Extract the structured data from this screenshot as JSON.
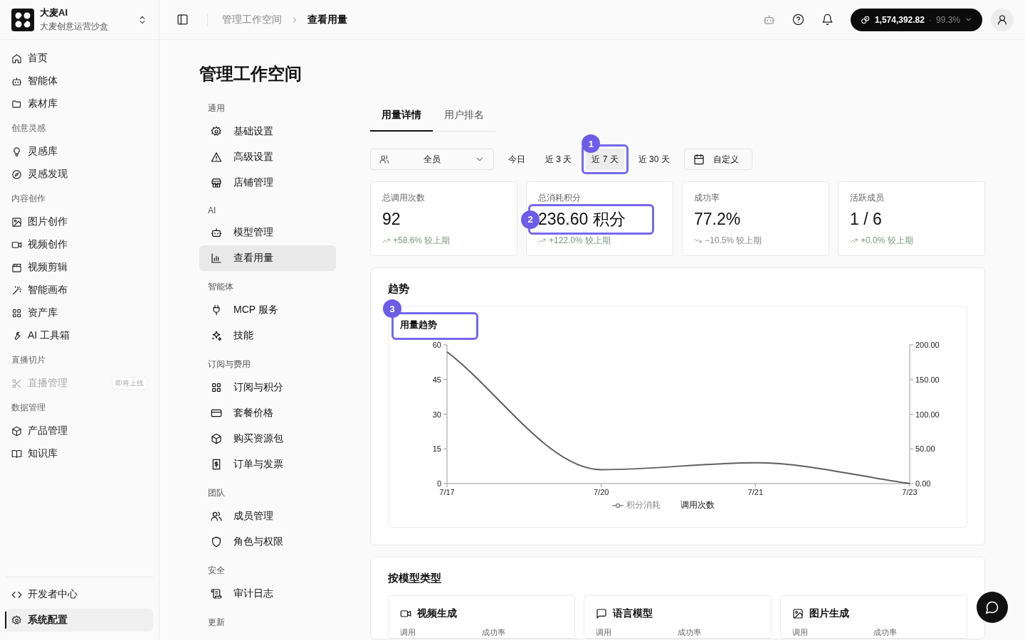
{
  "brand": {
    "name": "大麦AI",
    "subtitle": "大麦创意运营沙盒"
  },
  "breadcrumb": [
    "管理工作空间",
    "查看用量"
  ],
  "header": {
    "balance": "1,574,392.82",
    "separator": "·",
    "rate": "99.3%"
  },
  "sidebar": {
    "groups": [
      {
        "items": [
          {
            "label": "首页",
            "selected": false,
            "disabled": false
          },
          {
            "label": "智能体",
            "selected": false,
            "disabled": false
          },
          {
            "label": "素材库",
            "selected": false,
            "disabled": false
          }
        ]
      },
      {
        "title": "创意灵感",
        "items": [
          {
            "label": "灵感库",
            "selected": false,
            "disabled": false
          },
          {
            "label": "灵感发现",
            "selected": false,
            "disabled": false
          }
        ]
      },
      {
        "title": "内容创作",
        "items": [
          {
            "label": "图片创作",
            "selected": false,
            "disabled": false
          },
          {
            "label": "视频创作",
            "selected": false,
            "disabled": false
          },
          {
            "label": "视频剪辑",
            "selected": false,
            "disabled": false
          },
          {
            "label": "智能画布",
            "selected": false,
            "disabled": false
          },
          {
            "label": "资产库",
            "selected": false,
            "disabled": false
          },
          {
            "label": "AI 工具箱",
            "selected": false,
            "disabled": false
          }
        ]
      },
      {
        "title": "直播切片",
        "items": [
          {
            "label": "直播管理",
            "selected": false,
            "disabled": true,
            "badge": "即将上线"
          }
        ]
      },
      {
        "title": "数据管理",
        "items": [
          {
            "label": "产品管理",
            "selected": false,
            "disabled": false
          },
          {
            "label": "知识库",
            "selected": false,
            "disabled": false
          }
        ]
      }
    ],
    "footer_items": [
      {
        "label": "开发者中心",
        "selected": false
      },
      {
        "label": "系统配置",
        "selected": true
      }
    ]
  },
  "page_title": "管理工作空间",
  "settings_nav": [
    {
      "title": "通用",
      "items": [
        {
          "label": "基础设置",
          "selected": false
        },
        {
          "label": "高级设置",
          "selected": false
        },
        {
          "label": "店铺管理",
          "selected": false
        }
      ]
    },
    {
      "title": "AI",
      "items": [
        {
          "label": "模型管理",
          "selected": false
        },
        {
          "label": "查看用量",
          "selected": true
        }
      ]
    },
    {
      "title": "智能体",
      "items": [
        {
          "label": "MCP 服务",
          "selected": false
        },
        {
          "label": "技能",
          "selected": false
        }
      ]
    },
    {
      "title": "订阅与费用",
      "items": [
        {
          "label": "订阅与积分",
          "selected": false
        },
        {
          "label": "套餐价格",
          "selected": false
        },
        {
          "label": "购买资源包",
          "selected": false
        },
        {
          "label": "订单与发票",
          "selected": false
        }
      ]
    },
    {
      "title": "团队",
      "items": [
        {
          "label": "成员管理",
          "selected": false
        },
        {
          "label": "角色与权限",
          "selected": false
        }
      ]
    },
    {
      "title": "安全",
      "items": [
        {
          "label": "审计日志",
          "selected": false
        }
      ]
    },
    {
      "title": "更新"
    }
  ],
  "tabs": [
    {
      "label": "用量详情",
      "selected": true
    },
    {
      "label": "用户排名",
      "selected": false
    }
  ],
  "filters": {
    "member_select": "全员",
    "periods": [
      {
        "label": "今日",
        "selected": false
      },
      {
        "label": "近 3 天",
        "selected": false
      },
      {
        "label": "近 7 天",
        "selected": true,
        "callout": "1"
      },
      {
        "label": "近 30 天",
        "selected": false
      }
    ],
    "custom": "自定义"
  },
  "stats": [
    {
      "label": "总调用次数",
      "value": "92",
      "change": "+58.6% 较上期",
      "rising": true
    },
    {
      "label": "总消耗积分",
      "value": "236.60 积分",
      "change": "+122.0% 较上期",
      "rising": true,
      "callout": "2"
    },
    {
      "label": "成功率",
      "value": "77.2%",
      "change": "−10.5% 较上期",
      "rising": false
    },
    {
      "label": "活跃成员",
      "value": "1 / 6",
      "change": "+0.0% 较上期",
      "rising": true
    }
  ],
  "trend": {
    "title": "趋势",
    "chart_title": "用量趋势",
    "chart_callout": "3",
    "legend": [
      {
        "label": "积分消耗",
        "active": false
      },
      {
        "label": "调用次数",
        "active": true
      }
    ],
    "chart_data": {
      "type": "line",
      "categories": [
        "7/17",
        "7/20",
        "7/21",
        "7/23"
      ],
      "series": [
        {
          "color": "#5f5f5f",
          "values": [
            57,
            6,
            9,
            0
          ]
        }
      ],
      "ylim": [
        0,
        60
      ],
      "yticks": [
        0,
        15,
        30,
        45,
        60
      ]
    },
    "right_axis_ticks": [
      "200.00",
      "150.00",
      "100.00",
      "50.00",
      "0.00"
    ]
  },
  "model_types": {
    "title": "按模型类型",
    "cards": [
      {
        "name": "视频生成",
        "labels": [
          "调用",
          "成功率"
        ]
      },
      {
        "name": "语言模型",
        "labels": [
          "调用",
          "成功率"
        ]
      },
      {
        "name": "图片生成",
        "labels": [
          "调用",
          "成功率"
        ]
      }
    ]
  }
}
